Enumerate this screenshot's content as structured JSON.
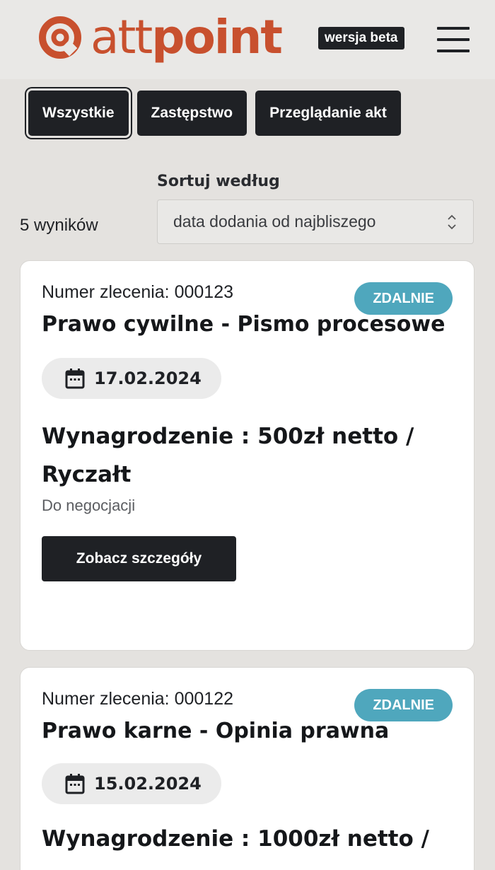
{
  "header": {
    "logo_text_light": "att",
    "logo_text_bold": "point",
    "beta_label": "wersja beta",
    "brand_color": "#c8502e"
  },
  "tabs": [
    {
      "label": "Wszystkie",
      "active": true
    },
    {
      "label": "Zastępstwo",
      "active": false
    },
    {
      "label": "Przeglądanie akt",
      "active": false
    }
  ],
  "sort": {
    "label": "Sortuj według",
    "selected": "data dodania od najbliszego"
  },
  "results": {
    "count_text": "5 wyników"
  },
  "cards": [
    {
      "order_number": "Numer zlecenia: 000123",
      "mode": "ZDALNIE",
      "title": "Prawo cywilne - Pismo procesowe",
      "date": "17.02.2024",
      "salary": "Wynagrodzenie : 500zł netto / Ryczałt",
      "negotiable": "Do negocjacji",
      "details_label": "Zobacz szczegóły"
    },
    {
      "order_number": "Numer zlecenia: 000122",
      "mode": "ZDALNIE",
      "title": "Prawo karne - Opinia prawna",
      "date": "15.02.2024",
      "salary": "Wynagrodzenie : 1000zł netto /"
    }
  ],
  "colors": {
    "badge": "#4fa7bd",
    "dark": "#1f2125",
    "background": "#e4e2df"
  }
}
